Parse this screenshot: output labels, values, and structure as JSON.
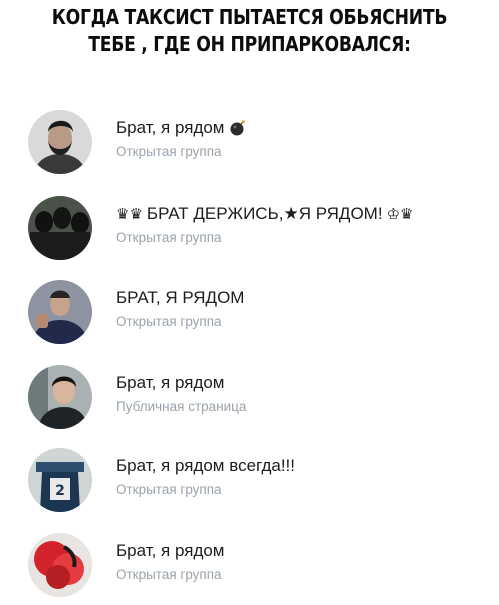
{
  "caption": {
    "line1": "КОГДА ТАКСИСТ ПЫТАЕТСЯ ОБЬЯСНИТЬ",
    "line2": "ТЕБЕ , ГДЕ ОН ПРИПАРКОВАЛСЯ:"
  },
  "groups": [
    {
      "title": "Брат, я рядом",
      "subtitle": "Открытая группа",
      "icon": "bomb-icon"
    },
    {
      "prefix": "♛♛",
      "title": "БРАТ ДЕРЖИСЬ,★Я РЯДОМ!",
      "suffix": "♔♛",
      "subtitle": "Открытая группа"
    },
    {
      "title": "БРАТ, Я РЯДОМ",
      "subtitle": "Открытая группа"
    },
    {
      "title": "Брат, я рядом",
      "subtitle": "Публичная страница"
    },
    {
      "title": "Брат, я рядом всегда!!!",
      "subtitle": "Открытая группа"
    },
    {
      "title": "Брат, я рядом",
      "subtitle": "Открытая группа"
    }
  ]
}
